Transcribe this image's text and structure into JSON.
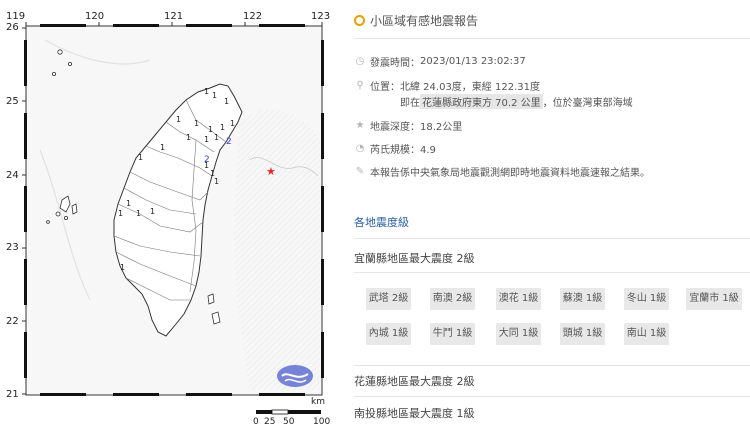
{
  "map": {
    "lon_ticks": [
      "119",
      "120",
      "121",
      "122",
      "123"
    ],
    "lat_ticks": [
      "26",
      "25",
      "24",
      "23",
      "22",
      "21"
    ],
    "intensity_labels": [
      "1",
      "2"
    ],
    "scale": {
      "unit": "km",
      "labels": [
        "0",
        "25",
        "50",
        "100"
      ]
    },
    "epicenter": {
      "lon": 122.31,
      "lat": 24.03,
      "color": "#e8262b"
    },
    "colors": {
      "land": "#ffffff",
      "sea": "#f7f7f7",
      "county_border": "#666666",
      "label": "#222222",
      "label_level2": "#3344cc",
      "logo": "#5f6fd0"
    }
  },
  "report": {
    "title": "小區域有感地震報告",
    "time_label": "發震時間：",
    "time": "2023/01/13 23:02:37",
    "location_line1": "位置：北緯 24.03度，東經 122.31度",
    "location_prefix": "即在",
    "location_highlight": "花蓮縣政府東方 70.2 公里",
    "location_suffix": "，位於臺灣東部海域",
    "depth": "地震深度：18.2公里",
    "magnitude": "芮氏規模：4.9",
    "note": "本報告係中央氣象局地震觀測網即時地震資料地震速報之結果。",
    "icons": [
      "clock-icon",
      "location-pin-icon",
      "star-icon",
      "magnitude-icon",
      "wrench-icon"
    ]
  },
  "intensity_section": {
    "link": "各地震度級",
    "counties": [
      {
        "title": "宜蘭縣地區最大震度 2級",
        "stations": [
          "武塔 2級",
          "南澳 2級",
          "澳花 1級",
          "蘇澳 1級",
          "冬山 1級",
          "宜蘭市 1級",
          "內城 1級",
          "牛鬥 1級",
          "大同 1級",
          "頭城 1級",
          "南山 1級"
        ]
      },
      {
        "title": "花蓮縣地區最大震度 2級",
        "stations": []
      },
      {
        "title": "南投縣地區最大震度 1級",
        "stations": []
      }
    ]
  }
}
